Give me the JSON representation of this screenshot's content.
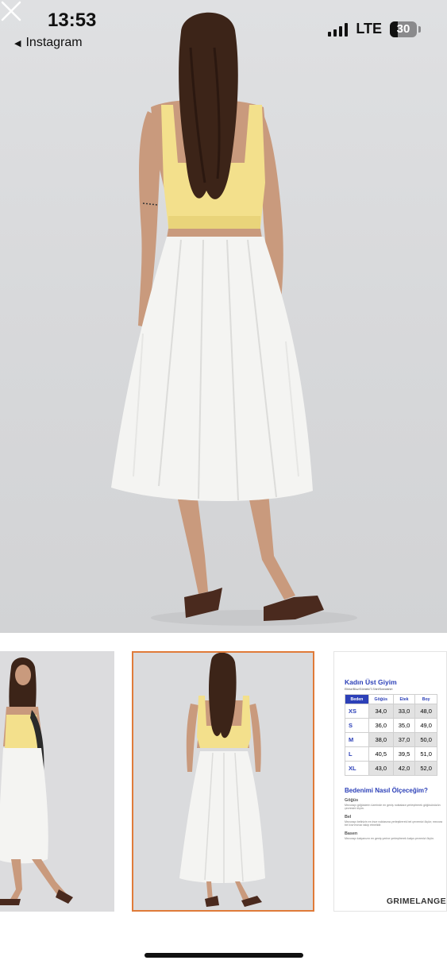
{
  "status_bar": {
    "time": "13:53",
    "back_label": "Instagram",
    "network": "LTE",
    "battery_level": "30",
    "battery_fraction": 0.3
  },
  "viewer": {
    "close_icon": "close-icon",
    "selected_thumbnail_index": 1,
    "accent_color": "#e07b39"
  },
  "size_chart": {
    "title": "Kadın Üst Giyim",
    "subtitle": "Elbise/Bluz/Gömlek/T-Shirt/Sweatshirt",
    "headers": [
      "Beden",
      "Göğüs",
      "Etek",
      "Boy"
    ],
    "rows": [
      [
        "XS",
        "34,0",
        "33,0",
        "48,0"
      ],
      [
        "S",
        "36,0",
        "35,0",
        "49,0"
      ],
      [
        "M",
        "38,0",
        "37,0",
        "50,0"
      ],
      [
        "L",
        "40,5",
        "39,5",
        "51,0"
      ],
      [
        "XL",
        "43,0",
        "42,0",
        "52,0"
      ]
    ],
    "how_to_title": "Bedenimi Nasıl Ölçeceğim?",
    "sections": [
      {
        "label": "Göğüs",
        "desc": "Mezurayı göğüslerin üzerinde en geniş noktalara yerleştirerek göğüsünüzün çevresini ölçün."
      },
      {
        "label": "Bel",
        "desc": "Mezurayı belinizin en ince noktasına yerleştirerek bel çevrenizi ölçün; mezura bel kıvrımınızı takip etmelidir."
      },
      {
        "label": "Basen",
        "desc": "Mezurayı kalçanızın en geniş yerine yerleştirerek kalça çevrenizi ölçün."
      }
    ],
    "brand": "GRIMELANGE"
  },
  "colors": {
    "chart_blue": "#2c40b8",
    "top_yellow": "#f3e08c",
    "skirt_white": "#f4f4f2"
  }
}
